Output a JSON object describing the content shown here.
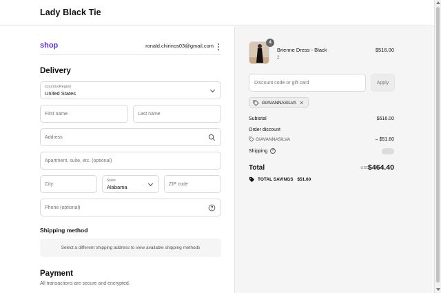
{
  "header": {
    "store_name": "Lady Black Tie"
  },
  "account": {
    "shop_logo": "shop",
    "email": "ronald.chirinos03@gmail.com"
  },
  "delivery": {
    "title": "Delivery",
    "country": {
      "label": "Country/Region",
      "value": "United States"
    },
    "first_name": {
      "placeholder": "First name"
    },
    "last_name": {
      "placeholder": "Last name"
    },
    "address": {
      "placeholder": "Address"
    },
    "apartment": {
      "placeholder": "Apartment, suite, etc. (optional)"
    },
    "city": {
      "placeholder": "City"
    },
    "state": {
      "label": "State",
      "value": "Alabama"
    },
    "zip": {
      "placeholder": "ZIP code"
    },
    "phone": {
      "placeholder": "Phone (optional)"
    }
  },
  "shipping_method": {
    "title": "Shipping method",
    "notice": "Select a different shipping address to view available shipping methods"
  },
  "payment": {
    "title": "Payment",
    "subtitle": "All transactions are secure and encrypted."
  },
  "order": {
    "item": {
      "name": "Brienne Dress - Black",
      "variant": "2",
      "quantity": "4",
      "price": "$516.00"
    },
    "discount_placeholder": "Discount code or gift card",
    "apply_label": "Apply",
    "applied_code": "GIAVANNASILVA",
    "subtotal_label": "Subtotal",
    "subtotal_value": "$516.00",
    "order_discount_label": "Order discount",
    "order_discount_code": "GIAVANNASILVA",
    "order_discount_value": "– $51.60",
    "shipping_label": "Shipping",
    "total_label": "Total",
    "currency": "USD",
    "total_value": "$464.40",
    "savings_label": "TOTAL SAVINGS",
    "savings_value": "$51.60"
  },
  "colors": {
    "accent": "#5a31f4",
    "sidebar_bg": "#f5f5f5"
  },
  "icons": [
    "search-icon",
    "help-icon",
    "tag-icon",
    "close-icon",
    "chevron-down-icon",
    "kebab-icon"
  ]
}
